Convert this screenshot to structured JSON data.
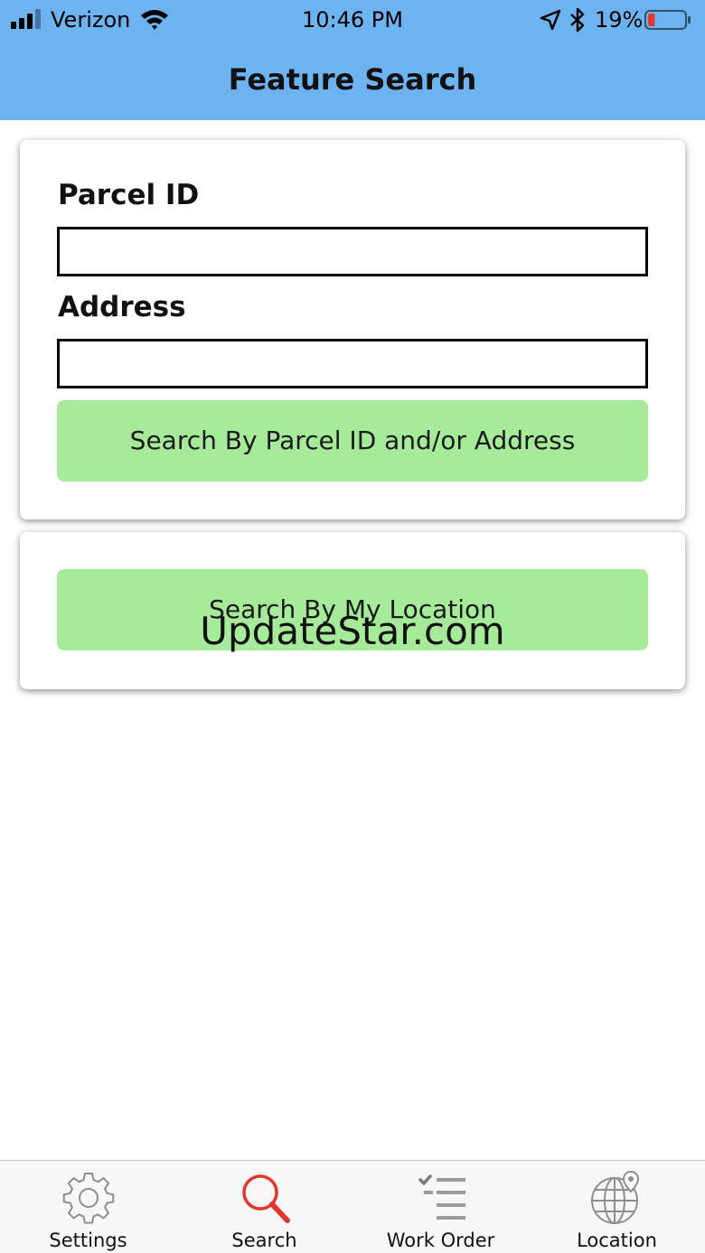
{
  "status_bar": {
    "carrier": "Verizon",
    "time": "10:46 PM",
    "battery_percent": "19%",
    "battery_level": 0.19,
    "icons": [
      "signal-icon",
      "wifi-icon",
      "location-arrow-icon",
      "bluetooth-icon",
      "battery-icon"
    ]
  },
  "nav": {
    "title": "Feature Search"
  },
  "search_form": {
    "parcel_label": "Parcel ID",
    "parcel_value": "",
    "address_label": "Address",
    "address_value": "",
    "parcel_search_button": "Search By Parcel ID and/or Address"
  },
  "location_search": {
    "button": "Search By My Location",
    "watermark": "UpdateStar.com"
  },
  "tabs": [
    {
      "label": "Settings",
      "icon": "gear-icon",
      "active": false
    },
    {
      "label": "Search",
      "icon": "search-icon",
      "active": true
    },
    {
      "label": "Work Order",
      "icon": "checklist-icon",
      "active": false
    },
    {
      "label": "Location",
      "icon": "globe-pin-icon",
      "active": false
    }
  ],
  "colors": {
    "nav_background": "#6db3f2",
    "button_green": "#a6eb99",
    "active_tab": "#e0362c",
    "inactive_tab": "#8e8e8e",
    "battery_low": "#e8352b"
  }
}
